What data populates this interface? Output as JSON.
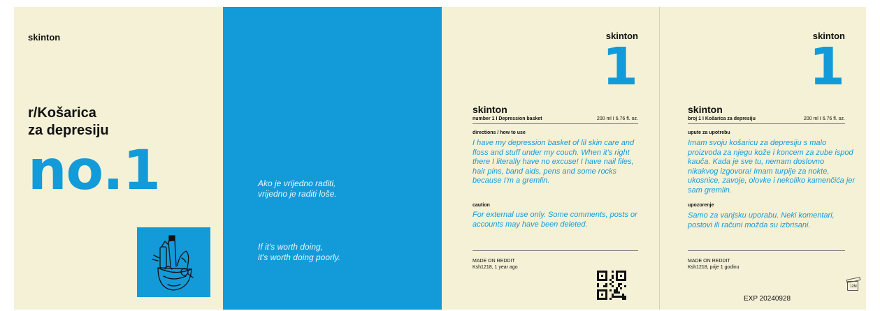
{
  "panel1": {
    "brand": "skinton",
    "title_line1": "r/Košarica",
    "title_line2": "za depresiju",
    "number": "no.1"
  },
  "panel2": {
    "quote_hr_line1": "Ako je vrijedno raditi,",
    "quote_hr_line2": "vrijedno je raditi loše.",
    "quote_en_line1": "If it's worth doing,",
    "quote_en_line2": "it's worth doing poorly."
  },
  "panel3": {
    "brand_top": "skinton",
    "big_number": "1",
    "label_brand": "skinton",
    "label_sub": "number 1 I Depression basket",
    "volume": "200 ml I 6.76 fl. oz.",
    "directions_heading": "directions / how to use",
    "directions_text": "I have my depression basket of lil skin care and floss and stuff under my couch. When it's right there I literally have no excuse! I have nail files, hair pins, band aids, pens and some rocks because I'm a gremlin.",
    "caution_heading": "caution",
    "caution_text": "For external use only. Some comments, posts or accounts may have been deleted.",
    "made_on": "MADE ON REDDIT",
    "author": "Ksh1218, 1 year ago"
  },
  "panel4": {
    "brand_top": "skinton",
    "big_number": "1",
    "label_brand": "skinton",
    "label_sub": "broj 1 I Košarica za depresiju",
    "volume": "200 ml I 6.76 fl. oz.",
    "directions_heading": "upute za upotrebu",
    "directions_text": "Imam svoju košaricu za depresiju s malo proizvoda za njegu kože i koncem za zube ispod kauča. Kada je sve tu, nemam doslovno nikakvog izgovora! Imam turpije za nokte, ukosnice, zavoje, olovke i nekoliko kamenčića jer sam gremlin.",
    "caution_heading": "upozorenje",
    "caution_text": "Samo za vanjsku uporabu. Neki komentari, postovi ili računi možda su izbrisani.",
    "made_on": "MADE ON REDDIT",
    "author": "Ksh1218, prije 1 godinu",
    "bin_symbol_number": "12M",
    "expiry": "EXP 20240928"
  },
  "colors": {
    "cream": "#f4f1d6",
    "blue": "#139bd9",
    "text": "#111111"
  },
  "icons": {
    "illustration": "basket-illustration-icon",
    "qr": "qr-code-icon",
    "period_after_opening": "open-jar-icon"
  }
}
